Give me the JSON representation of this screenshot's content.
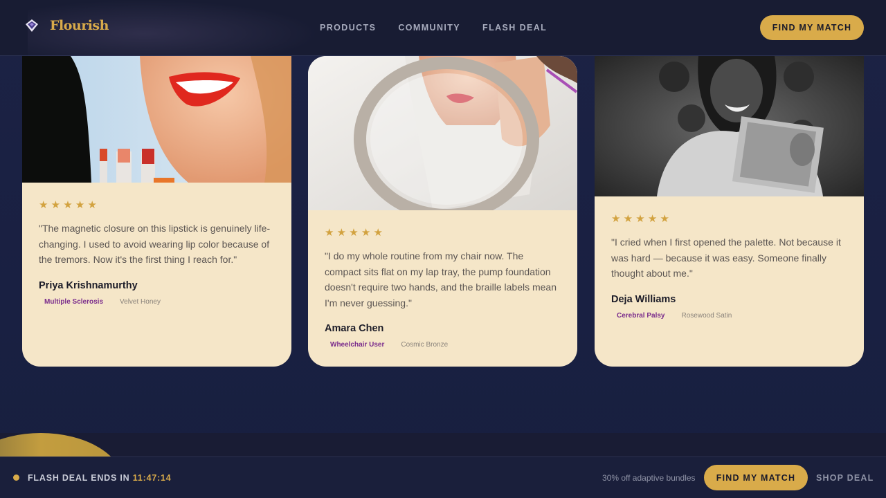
{
  "brand": {
    "name": "Flourish",
    "logo_icon": "gem-icon"
  },
  "nav": {
    "items": [
      {
        "label": "PRODUCTS"
      },
      {
        "label": "COMMUNITY"
      },
      {
        "label": "FLASH DEAL"
      }
    ],
    "cta_label": "FIND MY MATCH"
  },
  "testimonials": [
    {
      "rating": 5,
      "stars": "★ ★ ★ ★ ★",
      "quote": "\"The magnetic closure on this lipstick is genuinely life-changing. I used to avoid wearing lip color because of the tremors. Now it's the first thing I reach for.\"",
      "name": "Priya Krishnamurthy",
      "condition": "Multiple Sclerosis",
      "shade": "Velvet Honey"
    },
    {
      "rating": 5,
      "stars": "★ ★ ★ ★ ★",
      "quote": "\"I do my whole routine from my chair now. The compact sits flat on my lap tray, the pump foundation doesn't require two hands, and the braille labels mean I'm never guessing.\"",
      "name": "Amara Chen",
      "condition": "Wheelchair User",
      "shade": "Cosmic Bronze"
    },
    {
      "rating": 5,
      "stars": "★ ★ ★ ★ ★",
      "quote": "\"I cried when I first opened the palette. Not because it was hard — because it was easy. Someone finally thought about me.\"",
      "name": "Deja Williams",
      "condition": "Cerebral Palsy",
      "shade": "Rosewood Satin"
    }
  ],
  "flash_bar": {
    "label": "FLASH DEAL ENDS IN",
    "timer": "11:47:14",
    "promo": "30% off adaptive bundles",
    "cta_label": "FIND MY MATCH",
    "shop_label": "SHOP DEAL"
  },
  "colors": {
    "accent": "#d9ab4a",
    "background": "#1a2040",
    "card": "#f5e6c8",
    "condition_tag": "#7a2c8c"
  }
}
